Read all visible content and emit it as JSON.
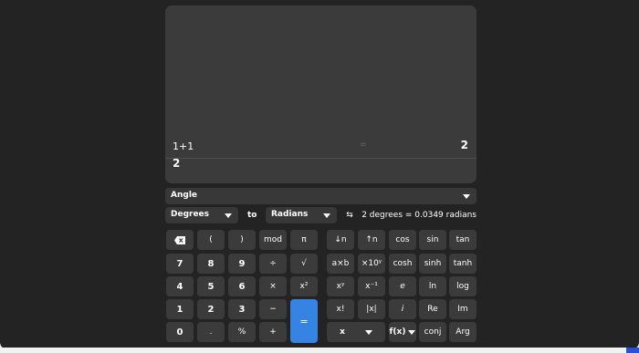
{
  "display": {
    "history_expression": "1+1",
    "history_equals": "=",
    "history_result": "2",
    "entry_value": "2"
  },
  "converter": {
    "category": "Angle",
    "from_unit": "Degrees",
    "to_label": "to",
    "to_unit": "Radians",
    "swap_symbol": "⇆",
    "result_text": "2 degrees  =  0.0349 radians"
  },
  "keypad": {
    "basic": [
      [
        "",
        "(",
        ")",
        "mod",
        "π"
      ],
      [
        "7",
        "8",
        "9",
        "÷",
        "√"
      ],
      [
        "4",
        "5",
        "6",
        "×",
        "x²"
      ],
      [
        "1",
        "2",
        "3",
        "−",
        "="
      ],
      [
        "0",
        ".",
        "%",
        "+",
        ""
      ]
    ],
    "advanced": [
      [
        "↓n",
        "↑n",
        "cos",
        "sin",
        "tan"
      ],
      [
        "a×b",
        "×10ʸ",
        "cosh",
        "sinh",
        "tanh"
      ],
      [
        "xʸ",
        "x⁻¹",
        "e",
        "ln",
        "log"
      ],
      [
        "x!",
        "|x|",
        "i",
        "Re",
        "Im"
      ],
      [
        "x",
        "f(x)",
        "conj",
        "Arg"
      ]
    ],
    "equals_color": "#3584e4"
  }
}
